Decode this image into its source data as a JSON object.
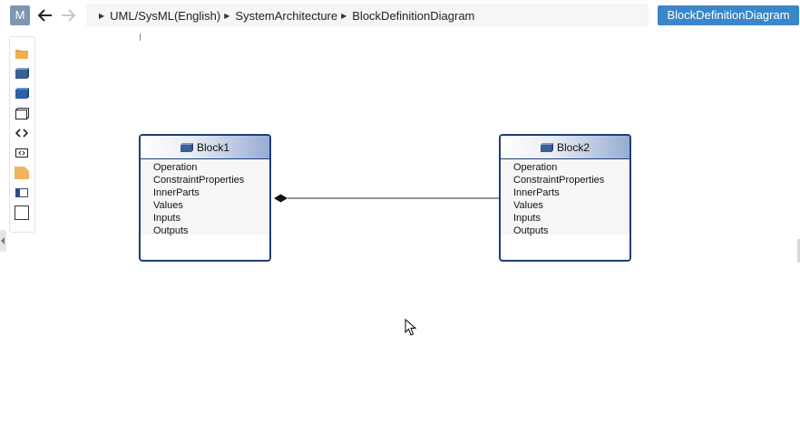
{
  "header": {
    "model_button": "M",
    "breadcrumb": [
      "UML/SysML(English)",
      "SystemArchitecture",
      "BlockDefinitionDiagram"
    ],
    "diagram_type": "BlockDefinitionDiagram"
  },
  "toolbar": {
    "tools": [
      "folder-icon",
      "block-icon",
      "block-filled-icon",
      "constraint-block-icon",
      "interface-icon",
      "value-type-icon",
      "package-icon",
      "part-icon",
      "rectangle-icon"
    ]
  },
  "blocks": [
    {
      "name": "Block1",
      "compartments": [
        "Operation",
        "ConstraintProperties",
        "InnerParts",
        "Values",
        "Inputs",
        "Outputs"
      ]
    },
    {
      "name": "Block2",
      "compartments": [
        "Operation",
        "ConstraintProperties",
        "InnerParts",
        "Values",
        "Inputs",
        "Outputs"
      ]
    }
  ],
  "relationship": {
    "type": "composition",
    "from": "Block1",
    "to": "Block2"
  }
}
